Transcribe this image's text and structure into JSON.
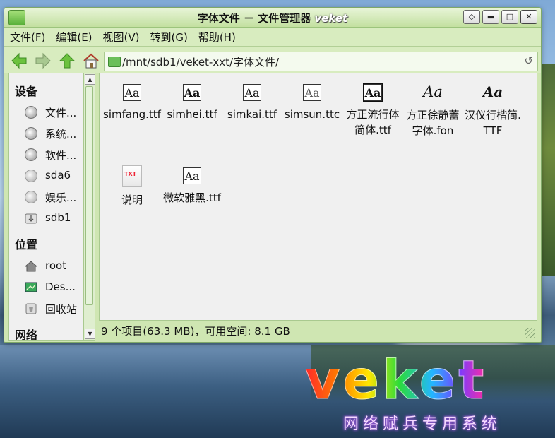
{
  "window": {
    "title_main": "字体文件 － 文件管理器",
    "title_brand": "veket",
    "controls": [
      "◇",
      "▬",
      "□",
      "✕"
    ]
  },
  "menu": [
    "文件(F)",
    "编辑(E)",
    "视图(V)",
    "转到(G)",
    "帮助(H)"
  ],
  "toolbar": {
    "back_icon": "left-arrow-icon",
    "forward_icon": "right-arrow-icon",
    "up_icon": "up-arrow-icon",
    "home_icon": "home-icon"
  },
  "path": {
    "value": "/mnt/sdb1/veket-xxt/字体文件/",
    "refresh_glyph": "↺"
  },
  "sidebar": {
    "devices_heading": "设备",
    "devices": [
      {
        "label": "文件..."
      },
      {
        "label": "系统..."
      },
      {
        "label": "软件..."
      },
      {
        "label": "sda6"
      },
      {
        "label": "娱乐..."
      },
      {
        "label": "sdb1"
      }
    ],
    "places_heading": "位置",
    "places": [
      {
        "label": "root",
        "icon": "home-icon"
      },
      {
        "label": "Des...",
        "icon": "desktop-icon"
      },
      {
        "label": "回收站",
        "icon": "trash-icon"
      }
    ],
    "network_heading": "网络"
  },
  "files": [
    {
      "name": "simfang.ttf",
      "glyph": "Aa"
    },
    {
      "name": "simhei.ttf",
      "glyph": "Aa"
    },
    {
      "name": "simkai.ttf",
      "glyph": "Aa"
    },
    {
      "name": "simsun.ttc",
      "glyph": "Aa"
    },
    {
      "name": "方正流行体简体.ttf",
      "glyph": "Aa"
    },
    {
      "name": "方正徐静蕾字体.fon",
      "glyph": "Aa"
    },
    {
      "name": "汉仪行楷简.TTF",
      "glyph": "Aa"
    },
    {
      "name": "说明",
      "glyph": "TXT"
    },
    {
      "name": "微软雅黑.ttf",
      "glyph": "Aa"
    }
  ],
  "status": "9 个项目(63.3 MB)，可用空间: 8.1 GB",
  "wallpaper": {
    "brand": "veket",
    "subtitle": "网络赋兵专用系统"
  },
  "colors": {
    "window_chrome": "#cfe6b2",
    "pane_bg": "#f0f0f0",
    "accent_green": "#59b13a"
  }
}
